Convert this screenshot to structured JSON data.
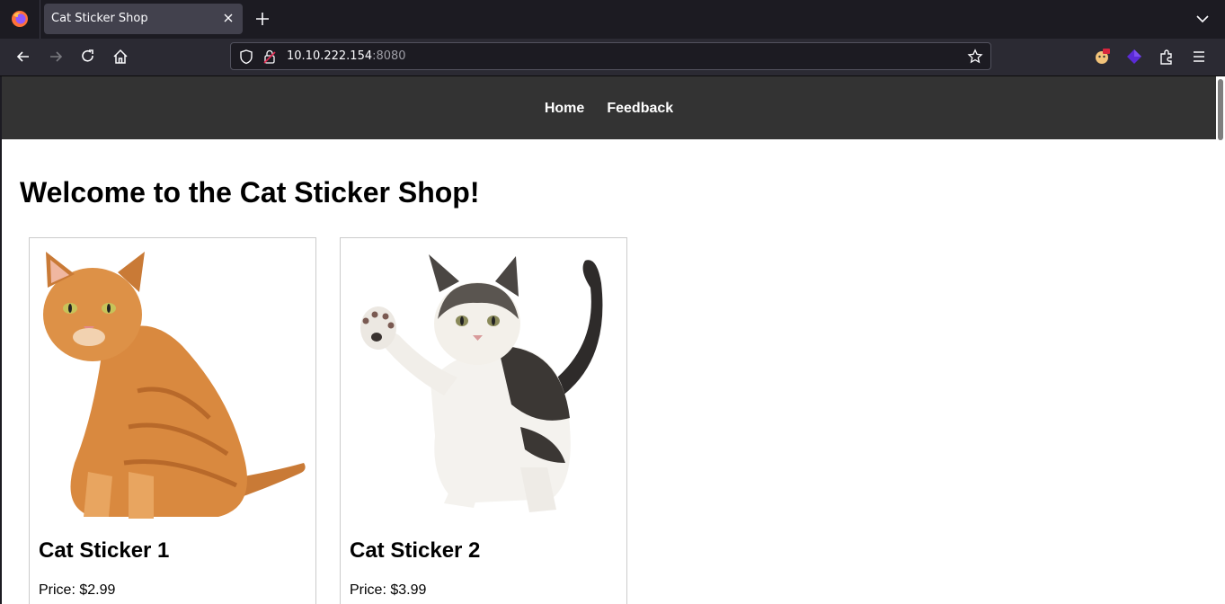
{
  "browser": {
    "tab_title": "Cat Sticker Shop",
    "url_host": "10.10.222.154",
    "url_port": ":8080"
  },
  "site": {
    "nav": [
      "Home",
      "Feedback"
    ],
    "heading": "Welcome to the Cat Sticker Shop!",
    "products": [
      {
        "name": "Cat Sticker 1",
        "price": "Price: $2.99"
      },
      {
        "name": "Cat Sticker 2",
        "price": "Price: $3.99"
      }
    ]
  },
  "colors": {
    "header_bg": "#333333",
    "orange_cat": "#d9893f",
    "tabby_cat": "#5a5550"
  },
  "icons": [
    "firefox-logo-icon",
    "close-icon",
    "plus-icon",
    "chevron-down-icon",
    "back-icon",
    "forward-icon",
    "reload-icon",
    "home-icon",
    "shield-icon",
    "lock-icon",
    "star-icon",
    "extension-icon",
    "puzzle-icon",
    "menu-icon"
  ]
}
